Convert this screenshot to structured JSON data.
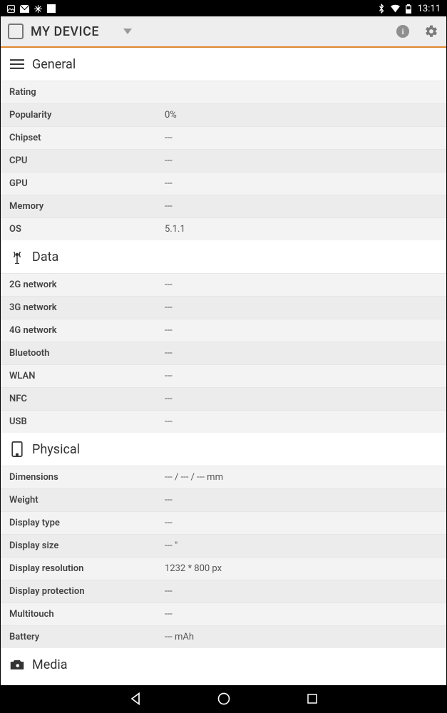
{
  "statusbar": {
    "time": "13:11"
  },
  "actionbar": {
    "title": "MY DEVICE"
  },
  "sections": {
    "general": {
      "title": "General",
      "rows": [
        {
          "label": "Rating",
          "value": ""
        },
        {
          "label": "Popularity",
          "value": "0%"
        },
        {
          "label": "Chipset",
          "value": "---"
        },
        {
          "label": "CPU",
          "value": "---"
        },
        {
          "label": "GPU",
          "value": "---"
        },
        {
          "label": "Memory",
          "value": "---"
        },
        {
          "label": "OS",
          "value": "5.1.1"
        }
      ]
    },
    "data": {
      "title": "Data",
      "rows": [
        {
          "label": "2G network",
          "value": "---"
        },
        {
          "label": "3G network",
          "value": "---"
        },
        {
          "label": "4G network",
          "value": "---"
        },
        {
          "label": "Bluetooth",
          "value": "---"
        },
        {
          "label": "WLAN",
          "value": "---"
        },
        {
          "label": "NFC",
          "value": "---"
        },
        {
          "label": "USB",
          "value": "---"
        }
      ]
    },
    "physical": {
      "title": "Physical",
      "rows": [
        {
          "label": "Dimensions",
          "value": "--- / --- / --- mm"
        },
        {
          "label": "Weight",
          "value": "---"
        },
        {
          "label": "Display type",
          "value": "---"
        },
        {
          "label": "Display size",
          "value": "--- \""
        },
        {
          "label": "Display resolution",
          "value": "1232 * 800 px"
        },
        {
          "label": "Display protection",
          "value": "---"
        },
        {
          "label": "Multitouch",
          "value": "---"
        },
        {
          "label": "Battery",
          "value": "--- mAh"
        }
      ]
    },
    "media": {
      "title": "Media"
    }
  }
}
